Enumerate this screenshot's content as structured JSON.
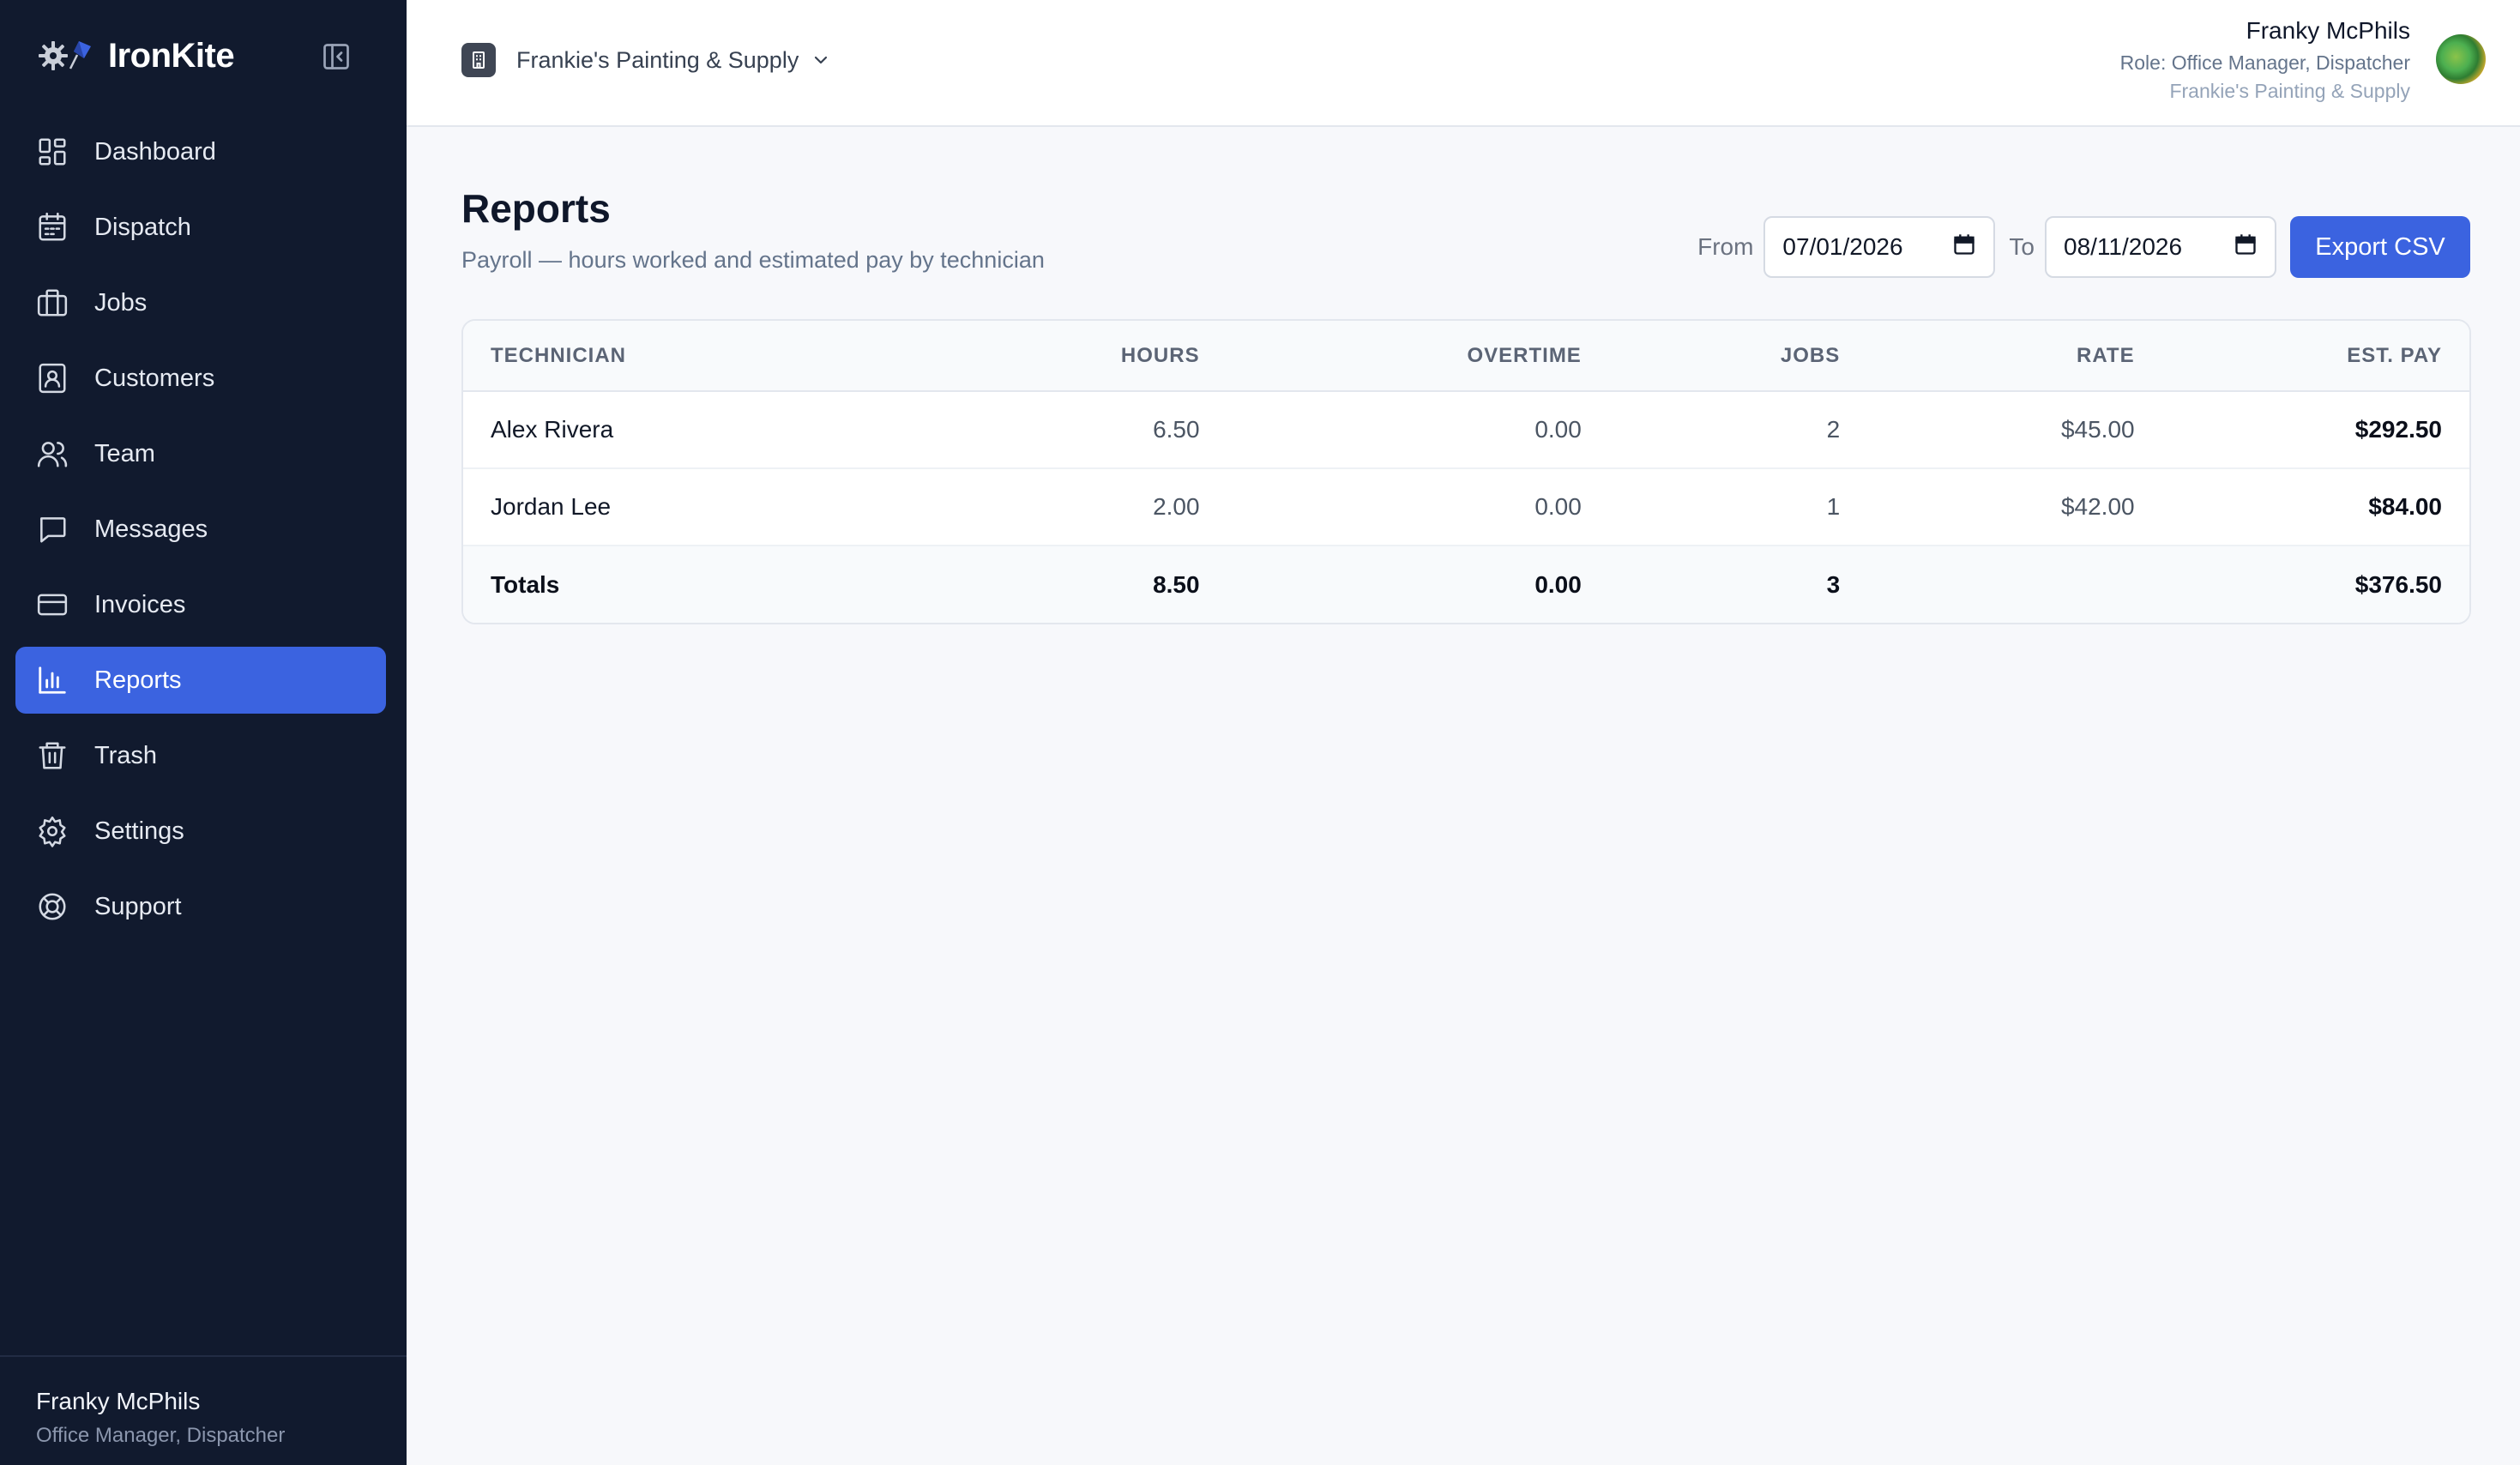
{
  "app": {
    "name": "IronKite"
  },
  "sidebar": {
    "items": [
      {
        "label": "Dashboard",
        "icon": "dashboard-icon"
      },
      {
        "label": "Dispatch",
        "icon": "calendar-icon"
      },
      {
        "label": "Jobs",
        "icon": "briefcase-icon"
      },
      {
        "label": "Customers",
        "icon": "contact-card-icon"
      },
      {
        "label": "Team",
        "icon": "users-icon"
      },
      {
        "label": "Messages",
        "icon": "message-icon"
      },
      {
        "label": "Invoices",
        "icon": "credit-card-icon"
      },
      {
        "label": "Reports",
        "icon": "bar-chart-icon",
        "active": true
      },
      {
        "label": "Trash",
        "icon": "trash-icon"
      },
      {
        "label": "Settings",
        "icon": "gear-icon"
      },
      {
        "label": "Support",
        "icon": "lifebuoy-icon"
      }
    ],
    "footer": {
      "name": "Franky McPhils",
      "role": "Office Manager, Dispatcher"
    }
  },
  "topbar": {
    "org_name": "Frankie's Painting & Supply",
    "user": {
      "name": "Franky McPhils",
      "role": "Role: Office Manager, Dispatcher",
      "org": "Frankie's Painting & Supply"
    }
  },
  "page": {
    "title": "Reports",
    "subtitle": "Payroll — hours worked and estimated pay by technician"
  },
  "filters": {
    "from_label": "From",
    "from_value": "07/01/2026",
    "to_label": "To",
    "to_value": "08/11/2026",
    "export_label": "Export CSV"
  },
  "table": {
    "columns": [
      "TECHNICIAN",
      "HOURS",
      "OVERTIME",
      "JOBS",
      "RATE",
      "EST. PAY"
    ],
    "rows": [
      [
        "Alex Rivera",
        "6.50",
        "0.00",
        "2",
        "$45.00",
        "$292.50"
      ],
      [
        "Jordan Lee",
        "2.00",
        "0.00",
        "1",
        "$42.00",
        "$84.00"
      ]
    ],
    "totals": [
      "Totals",
      "8.50",
      "0.00",
      "3",
      "",
      "$376.50"
    ]
  },
  "colors": {
    "sidebar_bg": "#111a2e",
    "accent": "#3b63e0",
    "page_bg": "#f7f8fb"
  }
}
